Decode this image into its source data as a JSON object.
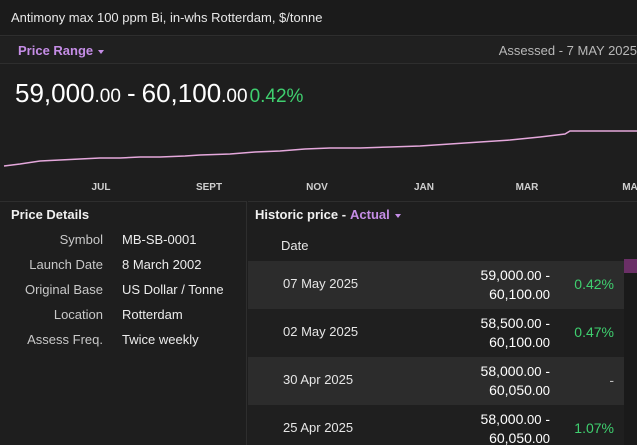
{
  "header": {
    "title": "Antimony max 100 ppm Bi, in-whs Rotterdam, $/tonne"
  },
  "range_bar": {
    "dropdown_label": "Price Range",
    "assessed": "Assessed - 7 MAY 2025"
  },
  "price": {
    "low_main": "59,000",
    "low_dec": ".00",
    "separator": "-",
    "high_main": "60,100",
    "high_dec": ".00",
    "change": "0.42%"
  },
  "chart": {
    "months": [
      "JUL",
      "SEPT",
      "NOV",
      "JAN",
      "MAR",
      "MA"
    ],
    "line_color": "#e5a8dc"
  },
  "details": {
    "title": "Price Details",
    "rows": [
      {
        "label": "Symbol",
        "value": "MB-SB-0001"
      },
      {
        "label": "Launch Date",
        "value": "8 March 2002"
      },
      {
        "label": "Original Base",
        "value": "US Dollar / Tonne"
      },
      {
        "label": "Location",
        "value": "Rotterdam"
      },
      {
        "label": "Assess Freq.",
        "value": "Twice weekly"
      }
    ]
  },
  "historic": {
    "title": "Historic price -",
    "mode": "Actual",
    "date_header": "Date",
    "rows": [
      {
        "date": "07 May 2025",
        "low_main": "59,000",
        "low_dec": ".00",
        "dash": " -",
        "high_main": "60,100",
        "high_dec": ".00",
        "change": "0.42%"
      },
      {
        "date": "02 May 2025",
        "low_main": "58,500",
        "low_dec": ".00",
        "dash": " -",
        "high_main": "60,100",
        "high_dec": ".00",
        "change": "0.47%"
      },
      {
        "date": "30 Apr 2025",
        "low_main": "58,000",
        "low_dec": ".00",
        "dash": " -",
        "high_main": "60,050",
        "high_dec": ".00",
        "change": "-"
      },
      {
        "date": "25 Apr 2025",
        "low_main": "58,000",
        "low_dec": ".00",
        "dash": " -",
        "high_main": "60,050",
        "high_dec": ".00",
        "change": "1.07%"
      }
    ]
  }
}
